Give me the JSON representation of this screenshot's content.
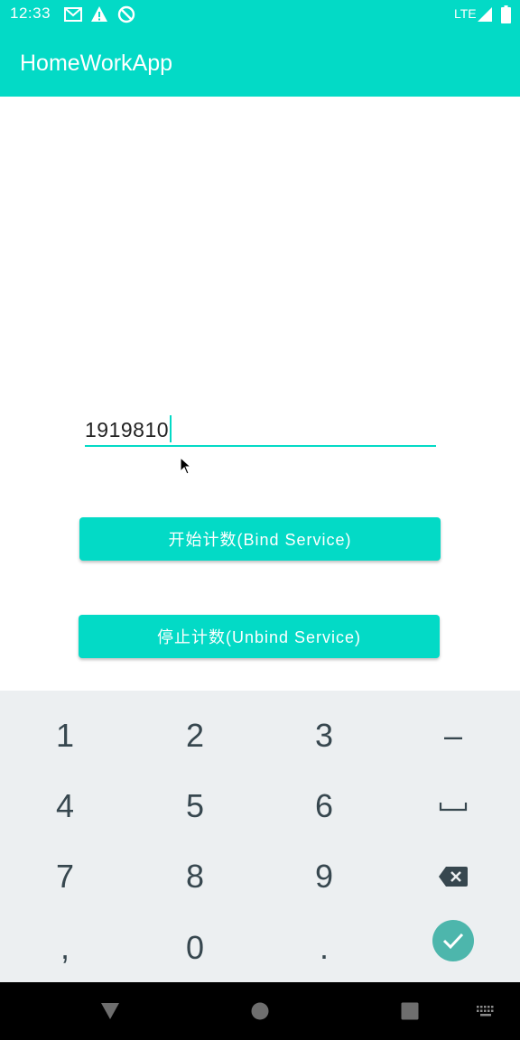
{
  "status_bar": {
    "time": "12:33",
    "network": "LTE",
    "icons": [
      "gmail-icon",
      "warning-icon",
      "no-sync-icon",
      "signal-icon",
      "battery-icon"
    ]
  },
  "app_bar": {
    "title": "HomeWorkApp"
  },
  "main": {
    "number_input": {
      "value": "1919810"
    },
    "start_button": {
      "label": "开始计数(Bind Service)"
    },
    "stop_button": {
      "label": "停止计数(Unbind Service)"
    }
  },
  "keyboard": {
    "rows": [
      [
        "1",
        "2",
        "3",
        "-"
      ],
      [
        "4",
        "5",
        "6",
        "space-icon"
      ],
      [
        "7",
        "8",
        "9",
        "backspace-icon"
      ],
      [
        ",",
        "0",
        ".",
        "done-check-icon"
      ]
    ],
    "labels": {
      "k1": "1",
      "k2": "2",
      "k3": "3",
      "kminus": "–",
      "k4": "4",
      "k5": "5",
      "k6": "6",
      "k7": "7",
      "k8": "8",
      "k9": "9",
      "kcomma": ",",
      "k0": "0",
      "kdot": "."
    }
  },
  "nav_bar": {
    "icons": [
      "back-icon",
      "home-icon",
      "recents-icon",
      "keyboard-switch-icon"
    ]
  },
  "colors": {
    "primary": "#03DAC6",
    "keyboard_bg": "#ECEFF1",
    "key_text": "#37474F",
    "done_key": "#4DB6AC"
  }
}
